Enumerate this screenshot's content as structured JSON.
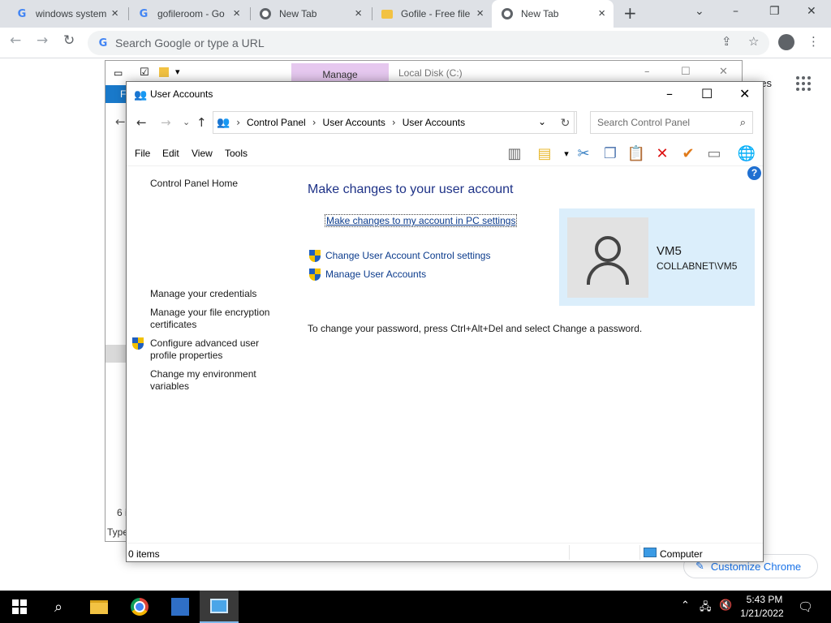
{
  "chrome": {
    "tabs": [
      {
        "title": "windows system",
        "icon": "google-g-icon"
      },
      {
        "title": "gofileroom - Go",
        "icon": "google-g-icon"
      },
      {
        "title": "New Tab",
        "icon": "chrome-icon"
      },
      {
        "title": "Gofile - Free file",
        "icon": "folder-icon"
      },
      {
        "title": "New Tab",
        "icon": "chrome-icon",
        "active": true
      }
    ],
    "omnibox_placeholder": "Search Google or type a URL",
    "images_link": "ges",
    "customize_chrome": "Customize Chrome"
  },
  "explorer_bg": {
    "manage_tab": "Manage",
    "address": "Local Disk (C:)",
    "ribbon_file": "F",
    "item_count": "6 i",
    "column_type": "Type"
  },
  "user_accounts": {
    "title": "User Accounts",
    "breadcrumb": [
      "Control Panel",
      "User Accounts",
      "User Accounts"
    ],
    "search_placeholder": "Search Control Panel",
    "menu": [
      "File",
      "Edit",
      "View",
      "Tools"
    ],
    "left_pane": {
      "home": "Control Panel Home",
      "credentials": "Manage your credentials",
      "encryption": "Manage your file encryption certificates",
      "advanced_profile": "Configure advanced user profile properties",
      "env_vars": "Change my environment variables"
    },
    "heading": "Make changes to your user account",
    "pc_settings_link": "Make changes to my account in PC settings",
    "uac_link": "Change User Account Control settings",
    "manage_accounts_link": "Manage User Accounts",
    "password_hint": "To change your password, press Ctrl+Alt+Del and select Change a password.",
    "user": {
      "name": "VM5",
      "account": "COLLABNET\\VM5"
    },
    "status": {
      "items": "0 items",
      "location": "Computer"
    }
  },
  "taskbar": {
    "time": "5:43 PM",
    "date": "1/21/2022"
  },
  "colors": {
    "heading": "#1e3287",
    "link": "#0b3b8c",
    "user_card": "#dbeefb",
    "manage_tab": "#e6c8ef",
    "help": "#1f6fd1"
  }
}
